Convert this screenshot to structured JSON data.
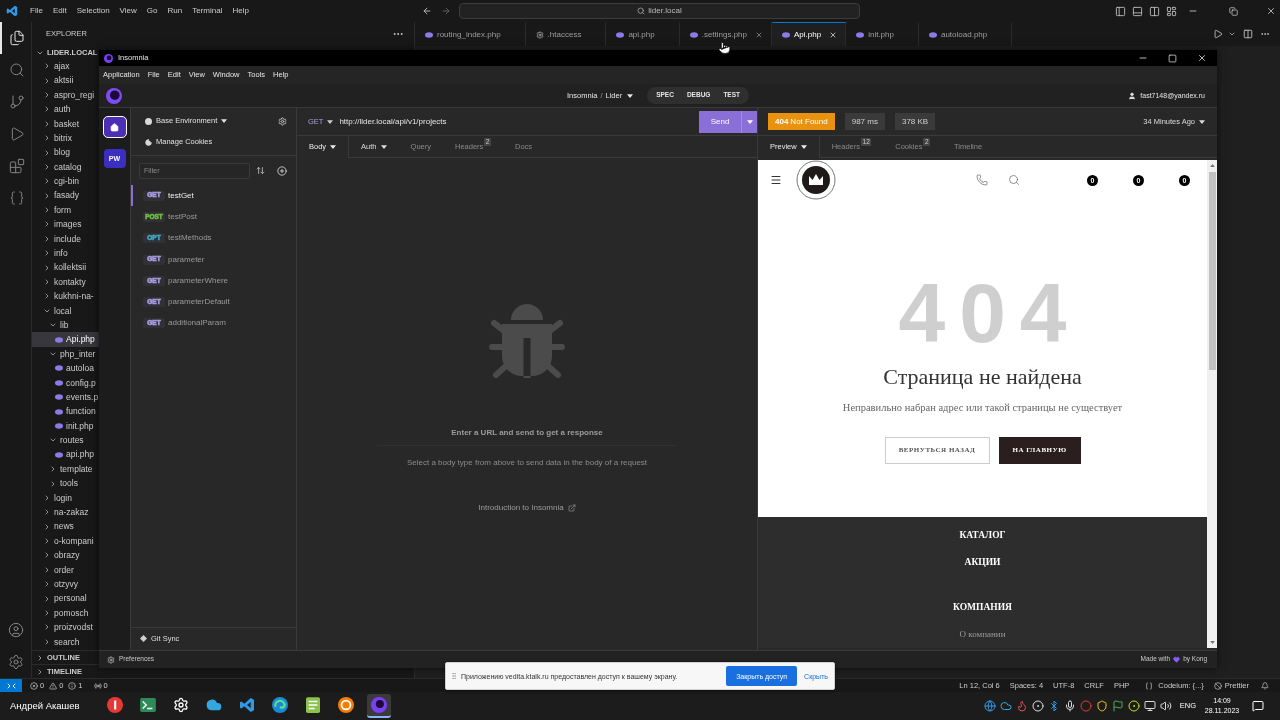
{
  "vscode": {
    "menu": [
      "File",
      "Edit",
      "Selection",
      "View",
      "Go",
      "Run",
      "Terminal",
      "Help"
    ],
    "search": {
      "value": "lider.local"
    },
    "activity_bar": [
      {
        "selected": true
      },
      {
        "selected": false
      },
      {
        "selected": false
      },
      {
        "selected": false
      },
      {
        "selected": false
      },
      {
        "selected": false
      }
    ],
    "explorer": {
      "title": "EXPLORER",
      "root": {
        "name": "LIDER.LOCAL",
        "expanded": true
      },
      "tree": [
        {
          "name": "ajax",
          "kind": "folder",
          "expanded": false,
          "selected": false
        },
        {
          "name": "aktsii",
          "kind": "folder",
          "expanded": false,
          "selected": false
        },
        {
          "name": "aspro_regi",
          "kind": "folder",
          "expanded": false,
          "selected": false
        },
        {
          "name": "auth",
          "kind": "folder",
          "expanded": false,
          "selected": false
        },
        {
          "name": "basket",
          "kind": "folder",
          "expanded": false,
          "selected": false
        },
        {
          "name": "bitrix",
          "kind": "folder",
          "expanded": false,
          "selected": false
        },
        {
          "name": "blog",
          "kind": "folder",
          "expanded": false,
          "selected": false
        },
        {
          "name": "catalog",
          "kind": "folder",
          "expanded": false,
          "selected": false
        },
        {
          "name": "cgi-bin",
          "kind": "folder",
          "expanded": false,
          "selected": false
        },
        {
          "name": "fasady",
          "kind": "folder",
          "expanded": false,
          "selected": false
        },
        {
          "name": "form",
          "kind": "folder",
          "expanded": false,
          "selected": false
        },
        {
          "name": "images",
          "kind": "folder",
          "expanded": false,
          "selected": false
        },
        {
          "name": "include",
          "kind": "folder",
          "expanded": false,
          "selected": false
        },
        {
          "name": "info",
          "kind": "folder",
          "expanded": false,
          "selected": false
        },
        {
          "name": "kollektsii",
          "kind": "folder",
          "expanded": false,
          "selected": false
        },
        {
          "name": "kontakty",
          "kind": "folder",
          "expanded": false,
          "selected": false
        },
        {
          "name": "kukhni-na-",
          "kind": "folder",
          "expanded": false,
          "selected": false
        },
        {
          "name": "local",
          "kind": "folder",
          "expanded": true,
          "selected": false,
          "children": [
            {
              "name": "lib",
              "kind": "folder",
              "expanded": true,
              "selected": false,
              "children": [
                {
                  "name": "Api.php",
                  "kind": "file",
                  "selected": true
                }
              ]
            },
            {
              "name": "php_inter",
              "kind": "folder",
              "expanded": true,
              "selected": false,
              "children": [
                {
                  "name": "autoloa",
                  "kind": "file",
                  "selected": false
                },
                {
                  "name": "config.p",
                  "kind": "file",
                  "selected": false
                },
                {
                  "name": "events.p",
                  "kind": "file",
                  "selected": false
                },
                {
                  "name": "function",
                  "kind": "file",
                  "selected": false
                },
                {
                  "name": "init.php",
                  "kind": "file",
                  "selected": false
                }
              ]
            },
            {
              "name": "routes",
              "kind": "folder",
              "expanded": true,
              "selected": false,
              "children": [
                {
                  "name": "api.php",
                  "kind": "file",
                  "selected": false
                }
              ]
            },
            {
              "name": "template",
              "kind": "folder",
              "expanded": false,
              "selected": false
            },
            {
              "name": "tools",
              "kind": "folder",
              "expanded": false,
              "selected": false
            }
          ]
        },
        {
          "name": "login",
          "kind": "folder",
          "expanded": false,
          "selected": false
        },
        {
          "name": "na-zakaz",
          "kind": "folder",
          "expanded": false,
          "selected": false
        },
        {
          "name": "news",
          "kind": "folder",
          "expanded": false,
          "selected": false
        },
        {
          "name": "o-kompani",
          "kind": "folder",
          "expanded": false,
          "selected": false
        },
        {
          "name": "obrazy",
          "kind": "folder",
          "expanded": false,
          "selected": false
        },
        {
          "name": "order",
          "kind": "folder",
          "expanded": false,
          "selected": false
        },
        {
          "name": "otzyvy",
          "kind": "folder",
          "expanded": false,
          "selected": false
        },
        {
          "name": "personal",
          "kind": "folder",
          "expanded": false,
          "selected": false
        },
        {
          "name": "pomosch",
          "kind": "folder",
          "expanded": false,
          "selected": false
        },
        {
          "name": "proizvodst",
          "kind": "folder",
          "expanded": false,
          "selected": false
        },
        {
          "name": "search",
          "kind": "folder",
          "expanded": false,
          "selected": false
        }
      ],
      "sections": [
        {
          "name": "OUTLINE",
          "expanded": false
        },
        {
          "name": "TIMELINE",
          "expanded": false
        }
      ]
    },
    "tabs": [
      {
        "label": "routing_index.php",
        "kind": "php",
        "selected": false,
        "close_button": false
      },
      {
        "label": ".htaccess",
        "kind": "config",
        "selected": false,
        "close_button": false
      },
      {
        "label": "api.php",
        "kind": "php",
        "selected": false,
        "close_button": false
      },
      {
        "label": ".settings.php",
        "kind": "php",
        "selected": false,
        "close_button": true
      },
      {
        "label": "Api.php",
        "kind": "php",
        "selected": true,
        "close_button": true
      },
      {
        "label": "init.php",
        "kind": "php",
        "selected": false,
        "close_button": false
      },
      {
        "label": "autoload.php",
        "kind": "php",
        "selected": false,
        "close_button": false
      }
    ],
    "status_bar": {
      "problems": [
        {
          "kind": "error",
          "count": "0"
        },
        {
          "kind": "warning",
          "count": "0"
        },
        {
          "kind": "info",
          "count": "1"
        }
      ],
      "ports": "0",
      "items": [
        "Ln 12, Col 6",
        "Spaces: 4",
        "UTF-8",
        "CRLF",
        "PHP"
      ],
      "codeium": "Codeium: {...}",
      "prettier": "Prettier"
    }
  },
  "insomnia": {
    "title": "Insomnia",
    "menu": [
      "Application",
      "File",
      "Edit",
      "View",
      "Window",
      "Tools",
      "Help"
    ],
    "breadcrumb": {
      "items": [
        "Insomnia",
        "Lider"
      ],
      "separator": "/"
    },
    "modes": [
      "SPEC",
      "DEBUG",
      "TEST"
    ],
    "user": "fast7148@yandex.ru",
    "rail": [
      {
        "kind": "home",
        "selected": true
      },
      {
        "kind": "project",
        "label": "PW",
        "selected": false
      }
    ],
    "sidebar": {
      "environment": "Base Environment",
      "cookies": "Manage Cookies",
      "filter": {
        "placeholder": "Filter"
      },
      "requests": [
        {
          "method": "GET",
          "name": "testGet",
          "color": "#a99ee0",
          "selected": true
        },
        {
          "method": "POST",
          "name": "testPost",
          "color": "#6fbf3c",
          "selected": false
        },
        {
          "method": "OPT",
          "name": "testMethods",
          "color": "#41a8c4",
          "selected": false
        },
        {
          "method": "GET",
          "name": "parameter",
          "color": "#a99ee0",
          "selected": false
        },
        {
          "method": "GET",
          "name": "parameterWhere",
          "color": "#a99ee0",
          "selected": false
        },
        {
          "method": "GET",
          "name": "parameterDefault",
          "color": "#a99ee0",
          "selected": false
        },
        {
          "method": "GET",
          "name": "additionalParam",
          "color": "#a99ee0",
          "selected": false
        }
      ],
      "git_sync": "Git Sync"
    },
    "request": {
      "method": "GET",
      "url": "http://lider.local/api/v1/projects",
      "send": "Send",
      "tabs": [
        {
          "label": "Body",
          "dropdown": true,
          "selected": true
        },
        {
          "label": "Auth",
          "dropdown": true,
          "selected": false
        },
        {
          "label": "Query",
          "dropdown": false,
          "selected": false
        },
        {
          "label": "Headers",
          "count": "2",
          "dropdown": false,
          "selected": false
        },
        {
          "label": "Docs",
          "dropdown": false,
          "selected": false
        }
      ],
      "empty": {
        "title": "Enter a URL and send to get a response",
        "hint": "Select a body type from above to send data in the body of a request",
        "link": "Introduction to Insomnia"
      }
    },
    "response": {
      "status": {
        "code": "404",
        "text": "Not Found",
        "kind": "client_error"
      },
      "time": "987 ms",
      "size": "378 KB",
      "when": "34 Minutes Ago",
      "tabs": [
        {
          "label": "Preview",
          "dropdown": true,
          "selected": true
        },
        {
          "label": "Headers",
          "count": "12",
          "dropdown": false,
          "selected": false
        },
        {
          "label": "Cookies",
          "count": "2",
          "dropdown": false,
          "selected": false
        },
        {
          "label": "Timeline",
          "dropdown": false,
          "selected": false
        }
      ],
      "preview": {
        "counters": [
          "0",
          "0",
          "0"
        ],
        "code": "404",
        "title": "Страница не найдена",
        "message": "Неправильно набран адрес или такой страницы не существует",
        "buttons": [
          {
            "label": "ВЕРНУТЬСЯ НАЗАД",
            "kind": "outline"
          },
          {
            "label": "НА ГЛАВНУЮ",
            "kind": "solid"
          }
        ],
        "footer": [
          {
            "items": [
              {
                "text": "КАТАЛОГ",
                "kind": "heading"
              },
              {
                "text": "АКЦИИ",
                "kind": "heading"
              }
            ]
          },
          {
            "items": [
              {
                "text": "КОМПАНИЯ",
                "kind": "heading"
              },
              {
                "text": "О компании",
                "kind": "link"
              }
            ]
          }
        ]
      }
    },
    "footer": {
      "preferences": "Preferences",
      "credit_before": "Made with",
      "credit_after": "by Kong"
    }
  },
  "notification": {
    "text": "Приложению vedita.ktalk.ru предоставлен доступ к вашему экрану.",
    "primary": "Закрыть доступ",
    "secondary": "Скрыть"
  },
  "taskbar": {
    "caption": "Андрей Акашев",
    "apps": [
      {
        "selected": false
      },
      {
        "selected": false
      },
      {
        "selected": false
      },
      {
        "selected": false
      },
      {
        "selected": false
      },
      {
        "selected": false
      },
      {
        "selected": false
      },
      {
        "selected": false
      },
      {
        "selected": true
      }
    ],
    "language": "ENG",
    "time": "14:09",
    "date": "28.11.2023"
  }
}
